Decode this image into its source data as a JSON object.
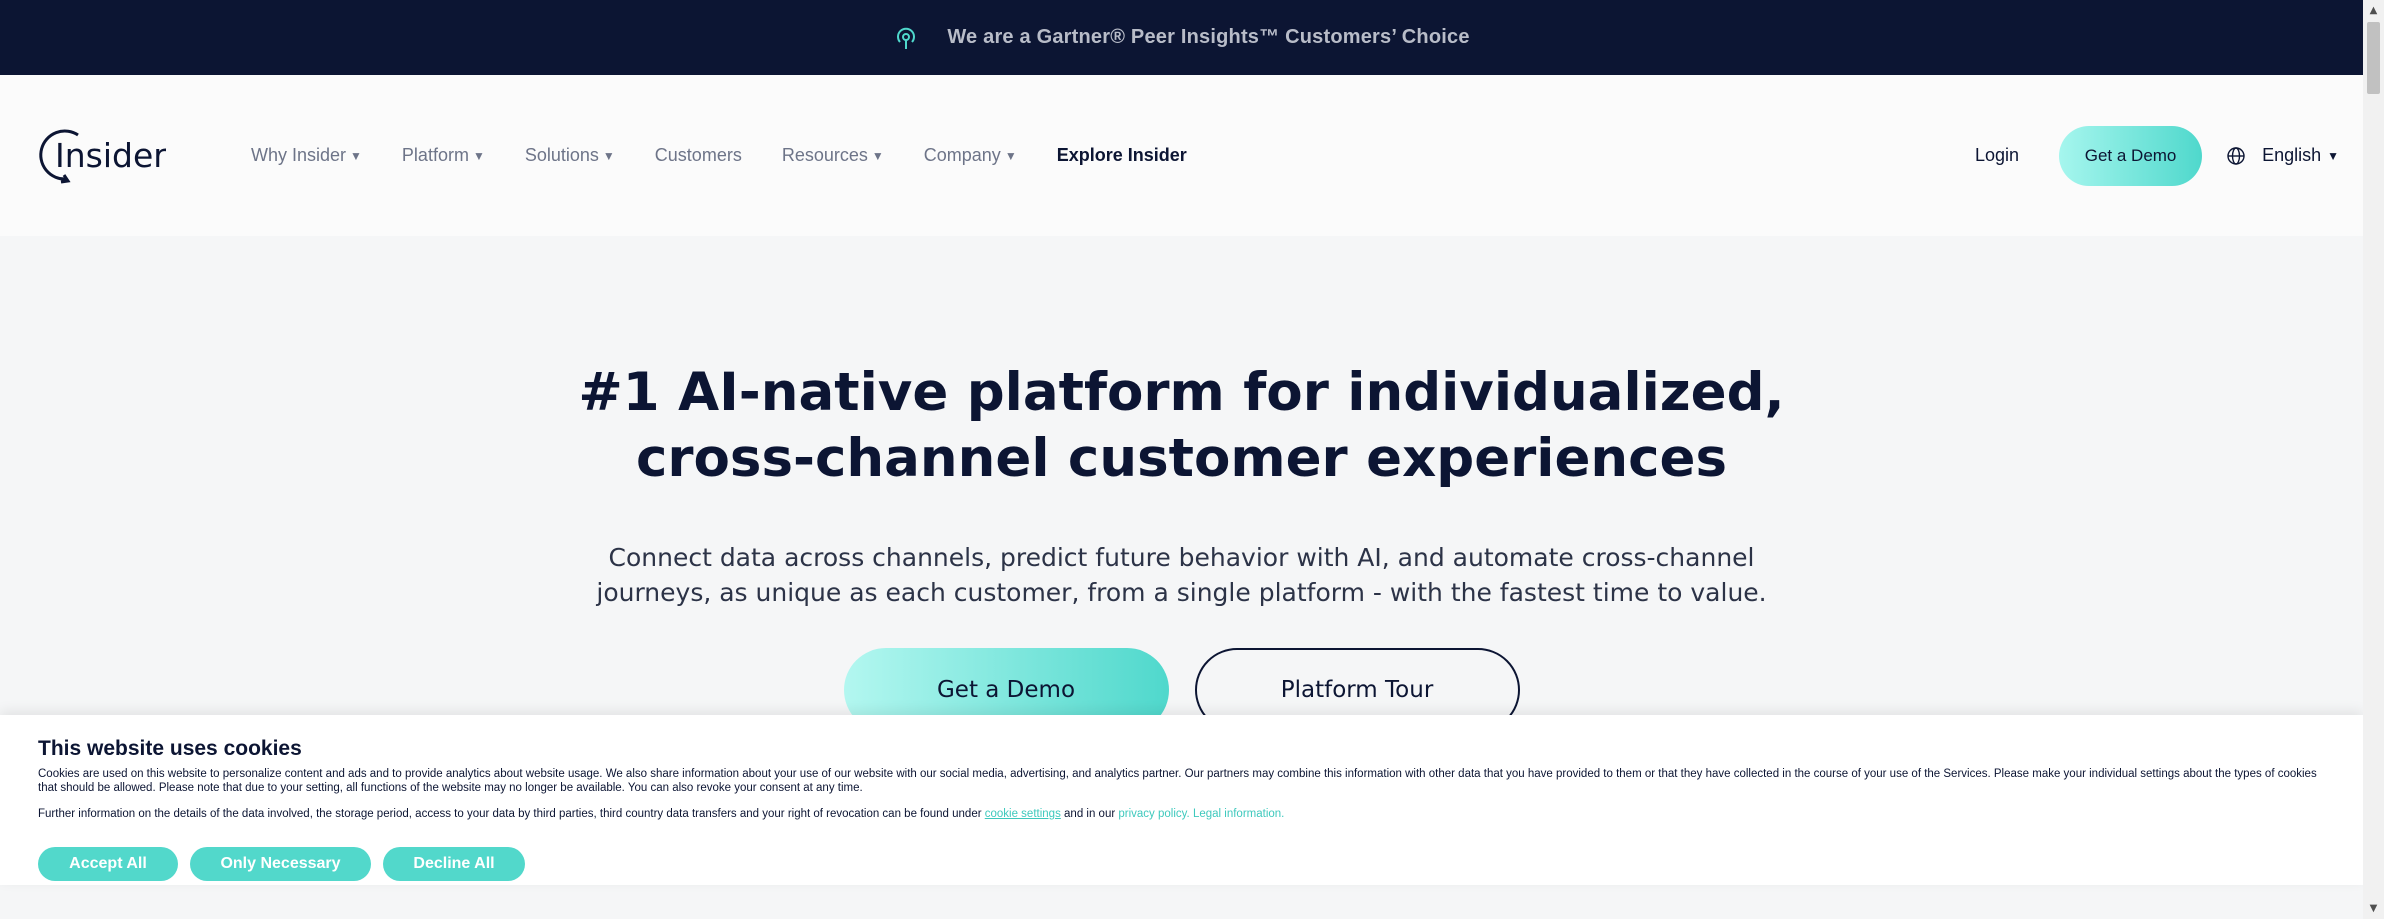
{
  "announcement": {
    "icon": "signal-icon",
    "text": "We are a Gartner® Peer Insights™ Customers’ Choice"
  },
  "nav": {
    "logo_text": "Insider",
    "items": [
      {
        "label": "Why Insider",
        "caret": "▼"
      },
      {
        "label": "Platform",
        "caret": "▼"
      },
      {
        "label": "Solutions",
        "caret": "▼"
      },
      {
        "label": "Customers",
        "caret": ""
      },
      {
        "label": "Resources",
        "caret": "▼"
      },
      {
        "label": "Company",
        "caret": "▼"
      },
      {
        "label": "Explore Insider",
        "caret": ""
      }
    ],
    "login": "Login",
    "demo": "Get a Demo",
    "language": "English",
    "language_caret": "▼"
  },
  "hero": {
    "title_line1": "#1 AI-native platform for individualized,",
    "title_line2": "cross-channel customer experiences",
    "sub_line1": "Connect data across channels, predict future behavior with AI, and automate cross-channel",
    "sub_line2": "journeys, as unique as each customer, from a single platform - with the fastest time to value.",
    "primary_cta": "Get a Demo",
    "secondary_cta": "Platform Tour"
  },
  "cookie": {
    "title": "This website uses cookies",
    "text1": "Cookies are used on this website to personalize content and ads and to provide analytics about website usage. We also share information about your use of our website with our social media, advertising, and analytics partner. Our partners may combine this information with other data that you have provided to them or that they have collected in the course of your use of the Services. Please make your individual settings about the types of cookies that should be allowed. Please note that due to your setting, all functions of the website may no longer be available. You can also revoke your consent at any time.",
    "text2_before": "Further information on the details of the data involved, the storage period, access to your data by third parties, third country data transfers and your right of revocation can be found under ",
    "link_settings": "cookie settings",
    "text2_middle": " and in our ",
    "link_privacy": "privacy policy.",
    "link_legal": "Legal information.",
    "buttons": {
      "accept": "Accept All",
      "necessary": "Only Necessary",
      "decline": "Decline All"
    }
  },
  "colors": {
    "topbar": "#0c1533",
    "accent": "#4fd8cc",
    "text_dark": "#0c1533"
  }
}
